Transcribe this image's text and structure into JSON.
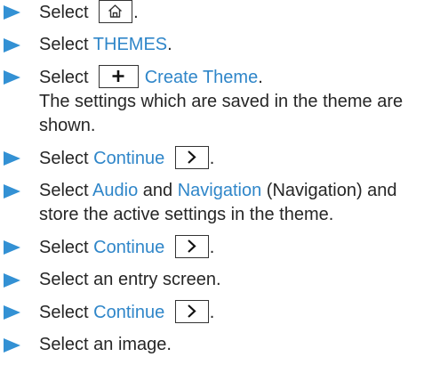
{
  "steps": [
    {
      "prefix": "Select",
      "suffix": ".",
      "icon": "home-icon"
    },
    {
      "prefix": "Select",
      "link": "THEMES",
      "suffix": "."
    },
    {
      "prefix": "Select",
      "icon": "plus-icon",
      "link": "Create Theme",
      "suffix": ".",
      "note": "The settings which are saved in the theme are shown."
    },
    {
      "prefix": "Select",
      "link": "Continue",
      "icon": "chevron-right-icon",
      "suffix": "."
    },
    {
      "prefix": "Select",
      "link1": "Audio",
      "mid1": "and",
      "link2": "Navigation",
      "rest": "(Navigation) and store the active settings in the theme."
    },
    {
      "prefix": "Select",
      "link": "Continue",
      "icon": "chevron-right-icon",
      "suffix": "."
    },
    {
      "text": "Select an entry screen."
    },
    {
      "prefix": "Select",
      "link": "Continue",
      "icon": "chevron-right-icon",
      "suffix": "."
    },
    {
      "text": "Select an image."
    }
  ],
  "colors": {
    "arrow": "#3391d4",
    "highlight": "#2f86c9",
    "text": "#262626"
  }
}
